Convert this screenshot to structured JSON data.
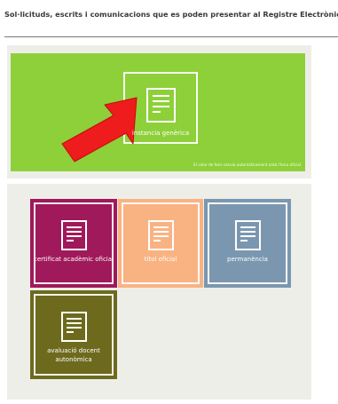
{
  "page": {
    "title": "Sol·licituds, escrits i comunicacions que es poden presentar al Registre Electrònic de la Universitat de Lleida"
  },
  "featured": {
    "note": "El color de fons canvia automàticament amb l'hora oficial",
    "tile_label": "instancia genèrica",
    "background": "#8ed03a"
  },
  "tiles": [
    {
      "label": "certificat acadèmic oficial",
      "color": "#a0195b"
    },
    {
      "label": "títol oficial",
      "color": "#f9b383"
    },
    {
      "label": "permanència",
      "color": "#7b97b0"
    },
    {
      "label": "avaluació docent autonòmica",
      "color": "#6d6a1d"
    }
  ],
  "icons": {
    "tile_icon": "document-icon",
    "pointer": "red-arrow-icon"
  },
  "colors": {
    "arrow": "#ee1c1c",
    "panel": "#eeeee9"
  }
}
